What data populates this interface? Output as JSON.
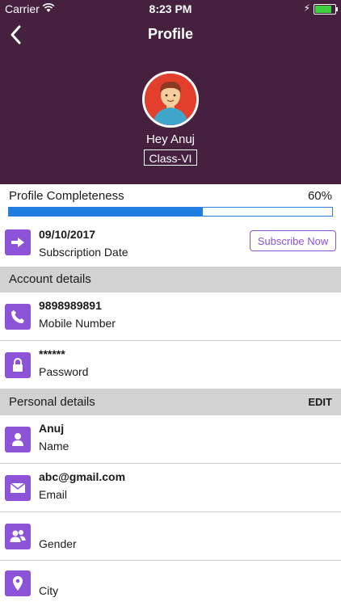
{
  "status": {
    "carrier": "Carrier",
    "time": "8:23 PM"
  },
  "header": {
    "title": "Profile",
    "greeting": "Hey Anuj",
    "class_label": "Class-VI"
  },
  "completeness": {
    "label": "Profile Completeness",
    "percent_text": "60%",
    "percent": 0.6
  },
  "subscription": {
    "date": "09/10/2017",
    "caption": "Subscription Date",
    "button": "Subscribe Now"
  },
  "account": {
    "section_label": "Account details",
    "mobile": {
      "value": "9898989891",
      "caption": "Mobile Number"
    },
    "password": {
      "value": "******",
      "caption": "Password"
    }
  },
  "personal": {
    "section_label": "Personal details",
    "edit_label": "EDIT",
    "name": {
      "value": "Anuj",
      "caption": "Name"
    },
    "email": {
      "value": "abc@gmail.com",
      "caption": "Email"
    },
    "gender": {
      "value": "",
      "caption": "Gender"
    },
    "city": {
      "value": "",
      "caption": "City"
    }
  },
  "colors": {
    "header_bg": "#46213f",
    "accent_purple": "#8c53d9",
    "progress_blue": "#1f7fe0",
    "section_bg": "#d2d2d2"
  },
  "icons": [
    "back-chevron-icon",
    "arrow-right-icon",
    "phone-icon",
    "lock-icon",
    "person-icon",
    "mail-icon",
    "people-icon",
    "location-pin-icon"
  ]
}
